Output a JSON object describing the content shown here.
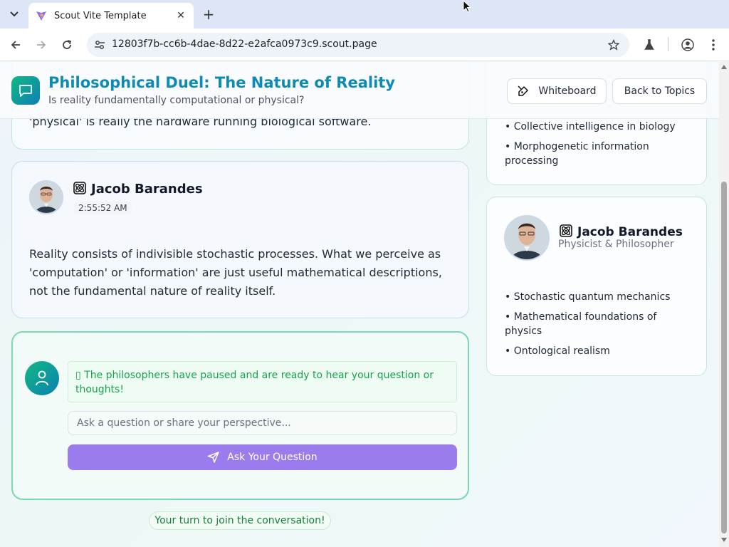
{
  "browser": {
    "tab_title": "Scout Vite Template",
    "url": "12803f7b-cc6b-4dae-8d22-e2afca0973c9.scout.page"
  },
  "header": {
    "title": "Philosophical Duel: The Nature of Reality",
    "subtitle": "Is reality fundamentally computational or physical?",
    "whiteboard_label": "Whiteboard",
    "back_label": "Back to Topics"
  },
  "conversation": {
    "previous_message_tail": "'physical' is really the hardware running biological software.",
    "messages": [
      {
        "speaker": "Jacob Barandes",
        "time": "2:55:52 AM",
        "text_lines": [
          "Reality consists of indivisible stochastic processes. What we perceive as",
          "'computation' or 'information' are just useful mathematical descriptions,",
          "not the fundamental nature of reality itself."
        ]
      }
    ]
  },
  "user_input": {
    "notice_lines": [
      "▯ The philosophers have paused and are ready to hear your question or",
      "thoughts!"
    ],
    "placeholder": "Ask a question or share your perspective...",
    "ask_label": "Ask Your Question",
    "turn_text": "Your turn to join the conversation!"
  },
  "sidebar": {
    "first_card_bullets": [
      "• Collective intelligence in biology",
      "• Morphogenetic information",
      "processing"
    ],
    "second_card": {
      "name": "Jacob Barandes",
      "role": "Physicist & Philosopher",
      "bullets": [
        "• Stochastic quantum mechanics",
        "• Mathematical foundations of",
        "physics",
        "• Ontological realism"
      ]
    }
  },
  "colors": {
    "accent_title": "#0e8bb0",
    "ask_button": "#9b7ced",
    "notice_text": "#16a34a"
  }
}
